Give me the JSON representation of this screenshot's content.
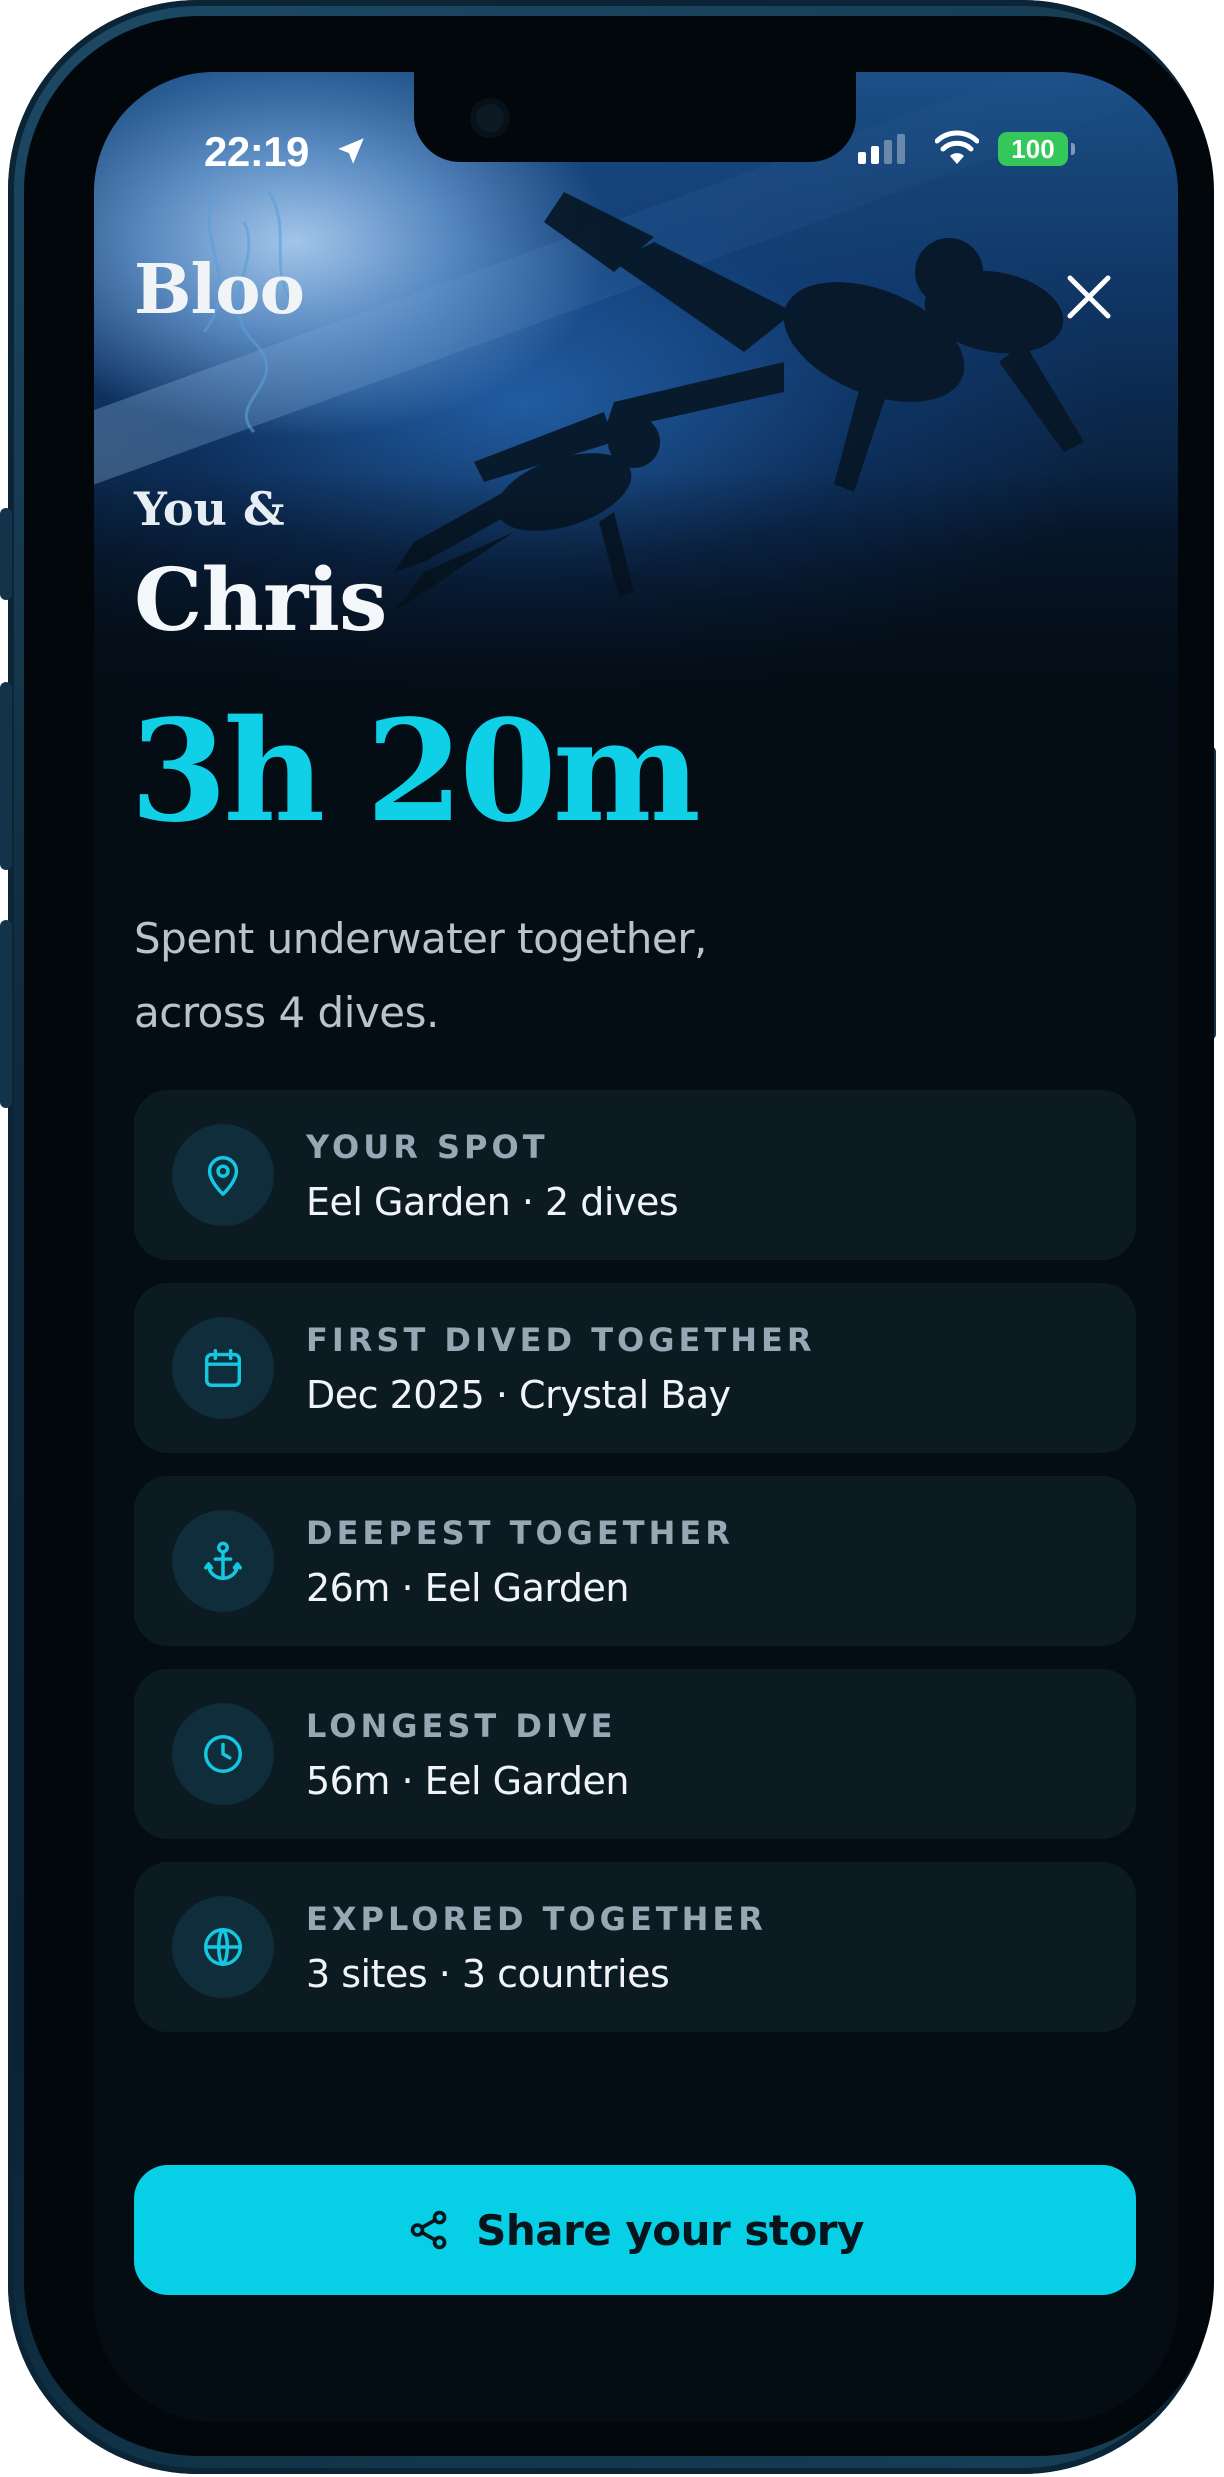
{
  "status_bar": {
    "time": "22:19",
    "battery": "100",
    "battery_color": "#34c759"
  },
  "header": {
    "logo": "Bloo",
    "close_icon": "close-icon"
  },
  "hero": {
    "prefix": "You &",
    "partner_name": "Chris",
    "total_time": "3h 20m",
    "subtitle_line1": "Spent underwater together,",
    "subtitle_line2": "across 4 dives."
  },
  "stats": [
    {
      "icon": "map-pin-icon",
      "label": "YOUR SPOT",
      "value": "Eel Garden · 2 dives"
    },
    {
      "icon": "calendar-icon",
      "label": "FIRST DIVED TOGETHER",
      "value": "Dec 2025 · Crystal Bay"
    },
    {
      "icon": "anchor-icon",
      "label": "DEEPEST TOGETHER",
      "value": "26m · Eel Garden"
    },
    {
      "icon": "clock-icon",
      "label": "LONGEST DIVE",
      "value": "56m · Eel Garden"
    },
    {
      "icon": "globe-icon",
      "label": "EXPLORED TOGETHER",
      "value": "3 sites · 3 countries"
    }
  ],
  "share_button": {
    "icon": "share-icon",
    "label": "Share your story"
  },
  "colors": {
    "accent": "#07cfe5",
    "headline": "#10d0e8",
    "card_bg": "#0c1a22",
    "icon_circle": "#0f2d3b"
  }
}
